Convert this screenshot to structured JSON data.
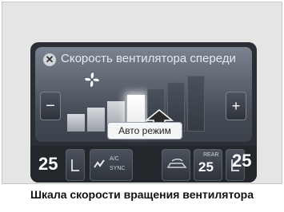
{
  "panel": {
    "title": "Скорость вентилятора спереди",
    "close_icon": "close-icon",
    "fan_icon": "fan-icon",
    "minus_label": "−",
    "plus_label": "+",
    "auto_label": "Авто режим",
    "fan_speed": {
      "levels": 7,
      "current": 4
    }
  },
  "bottom_bar": {
    "left_temp": "25",
    "right_temp": "25",
    "ac_label": "A/C",
    "sync_label": "SYNC",
    "rear_label": "REAR",
    "rear_temp": "25"
  },
  "caption": "Шкала скорости вращения вентилятора",
  "colors": {
    "panel_bg": "#454c56",
    "bar_active": "#ffffff",
    "bar_inactive": "#3a4048",
    "screen_bg": "#2b2f35"
  }
}
